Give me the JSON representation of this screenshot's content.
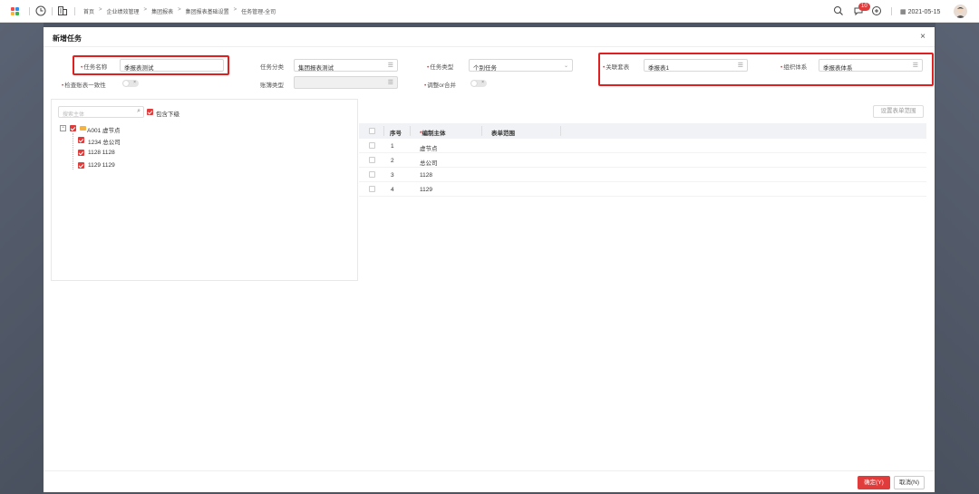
{
  "topbar": {
    "breadcrumbs": [
      "首页",
      "企业绩效管理",
      "集团报表",
      "集团报表基础设置",
      "任务管理-全司"
    ],
    "breadcrumb_sep": ">",
    "notification_count": "10",
    "date": "2021-05-15"
  },
  "dialog": {
    "title": "新增任务",
    "close": "×",
    "fields": {
      "task_name": {
        "label": "任务名称",
        "value": "季报表测试"
      },
      "task_category": {
        "label": "任务分类",
        "value": "集团报表测试"
      },
      "task_type": {
        "label": "任务类型",
        "value": "个别任务"
      },
      "linked_table": {
        "label": "关联套表",
        "value": "季报表1"
      },
      "org_system": {
        "label": "组织体系",
        "value": "季报表体系"
      },
      "check_consistency": {
        "label": "检查账表一致性",
        "toggle": "×"
      },
      "ledger_type": {
        "label": "账簿类型",
        "value": ""
      },
      "adjust_merge": {
        "label": "调整or合并",
        "toggle": "×"
      }
    },
    "tree": {
      "search_placeholder": "搜索主体",
      "include_children": "包含下级",
      "nodes": [
        {
          "label": "A001 虚节点"
        },
        {
          "label": "1234 总公司"
        },
        {
          "label": "1128 1128"
        },
        {
          "label": "1129 1129"
        }
      ]
    },
    "set_range_button": "设置表单范围",
    "table": {
      "headers": {
        "index": "序号",
        "entity": "编制主体",
        "range": "表单范围"
      },
      "rows": [
        {
          "index": "1",
          "entity": "虚节点"
        },
        {
          "index": "2",
          "entity": "总公司"
        },
        {
          "index": "3",
          "entity": "1128"
        },
        {
          "index": "4",
          "entity": "1129"
        }
      ]
    },
    "footer": {
      "ok": "确定(Y)",
      "cancel": "取消(N)"
    }
  },
  "colors": {
    "accent": "#e03c3c",
    "highlight_box": "#e02020",
    "header_bg": "#f0f2f5"
  }
}
